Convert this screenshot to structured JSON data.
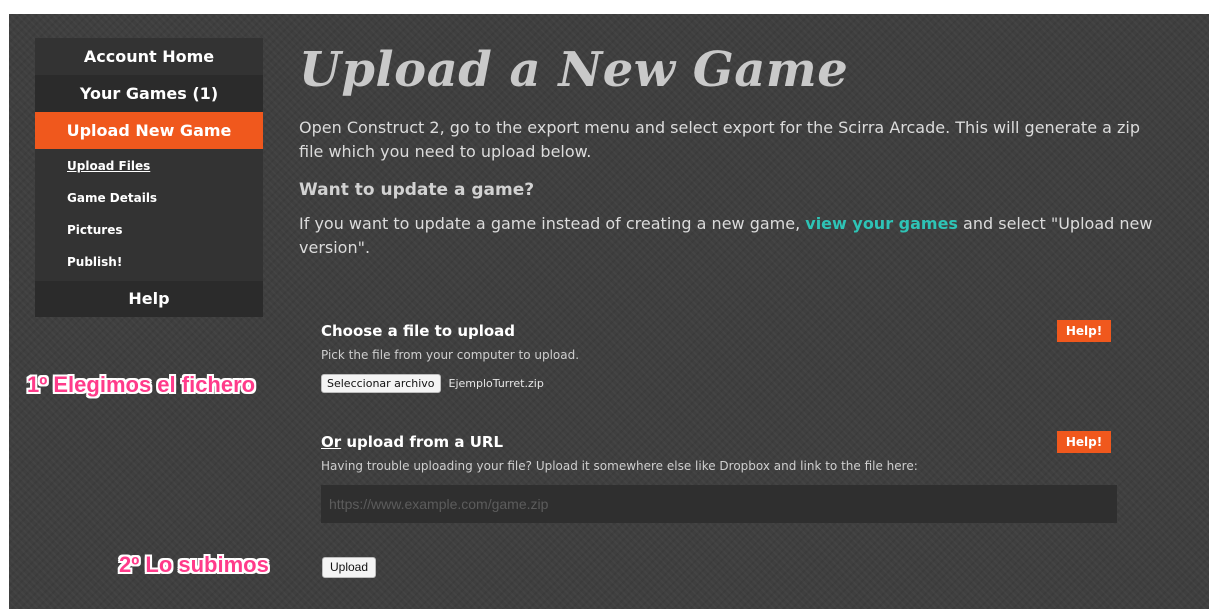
{
  "sidebar": {
    "account_home": "Account Home",
    "your_games": "Your Games (1)",
    "upload_new_game": "Upload New Game",
    "sub_items": [
      "Upload Files",
      "Game Details",
      "Pictures",
      "Publish!"
    ],
    "help": "Help"
  },
  "main": {
    "title": "Upload a New Game",
    "intro": "Open Construct 2, go to the export menu and select export for the Scirra Arcade. This will generate a zip file which you need to upload below.",
    "update_heading": "Want to update a game?",
    "update_text_before": "If you want to update a game instead of creating a new game, ",
    "update_link": "view your games",
    "update_text_after": " and select \"Upload new version\"."
  },
  "file_section": {
    "title": "Choose a file to upload",
    "description": "Pick the file from your computer to upload.",
    "help_label": "Help!",
    "choose_button": "Seleccionar archivo",
    "file_name": "EjemploTurret.zip"
  },
  "url_section": {
    "title_prefix": "Or",
    "title_rest": " upload from a URL",
    "description": "Having trouble uploading your file? Upload it somewhere else like Dropbox and link to the file here:",
    "help_label": "Help!",
    "placeholder": "https://www.example.com/game.zip"
  },
  "upload_button": "Upload",
  "annotations": {
    "step1": "1º Elegimos el fichero",
    "step2": "2º Lo subimos",
    "color": "#ff3b8a"
  },
  "colors": {
    "accent": "#f0581d",
    "link": "#2ec4b6",
    "background": "#3f3f3f"
  }
}
